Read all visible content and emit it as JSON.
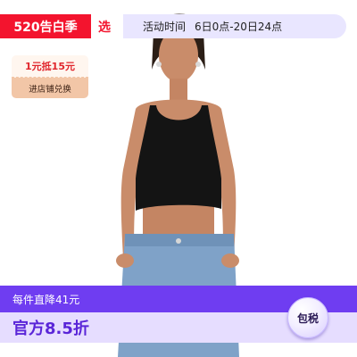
{
  "promo": {
    "event_label": "520告白季",
    "select_label": "选",
    "time_label": "活动时间",
    "time_range": "6日0点-20日24点"
  },
  "coupon": {
    "offer": "1元抵15元",
    "action": "进店铺兑换"
  },
  "banner": {
    "line1": "每件直降41元",
    "line2": "官方8.5折",
    "tax_badge": "包税"
  },
  "colors": {
    "brand_red": "#f3142e",
    "purple": "#6f3df1",
    "lavender": "#e6ddff"
  }
}
